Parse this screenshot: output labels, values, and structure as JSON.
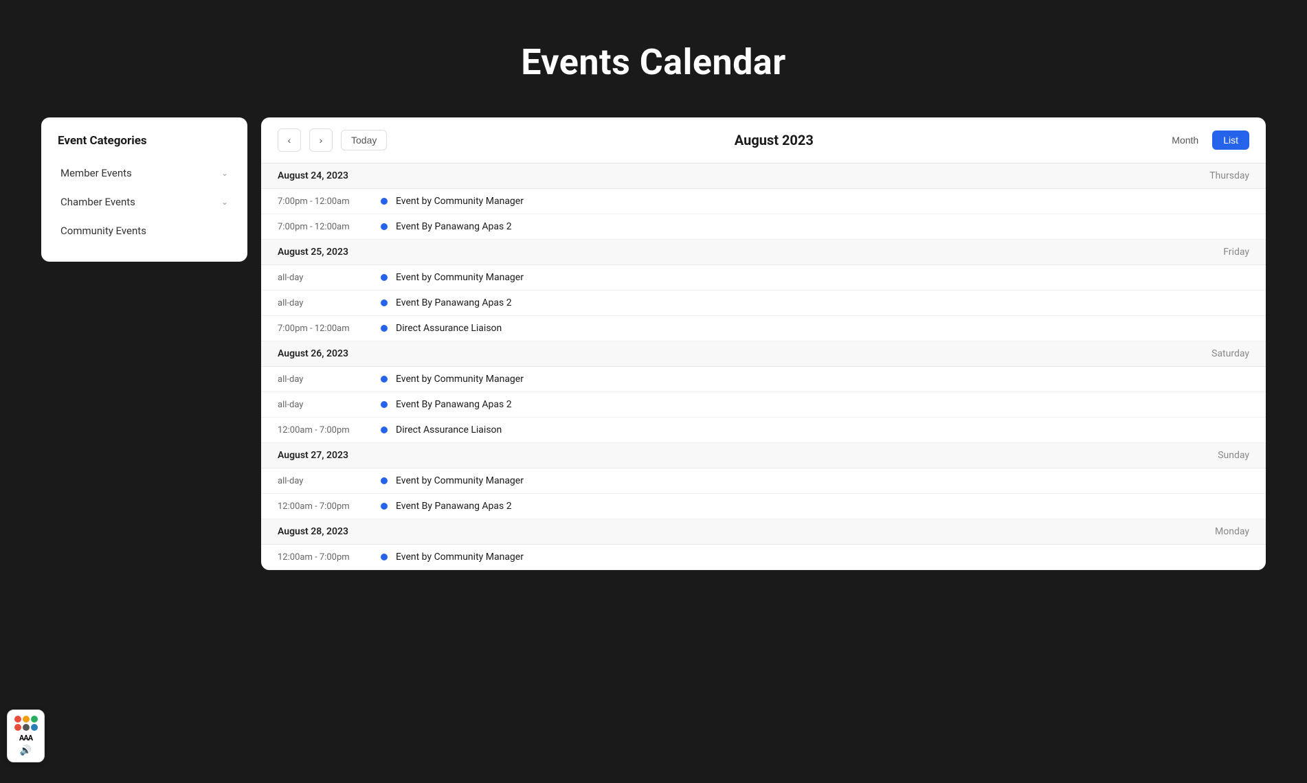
{
  "page": {
    "title": "Events Calendar"
  },
  "sidebar": {
    "title": "Event Categories",
    "categories": [
      {
        "id": "member-events",
        "label": "Member Events",
        "hasDropdown": true
      },
      {
        "id": "chamber-events",
        "label": "Chamber Events",
        "hasDropdown": true
      },
      {
        "id": "community-events",
        "label": "Community Events",
        "hasDropdown": false
      }
    ]
  },
  "calendar": {
    "current_month": "August 2023",
    "prev_label": "‹",
    "next_label": "›",
    "today_label": "Today",
    "view_month_label": "Month",
    "view_list_label": "List",
    "active_view": "list",
    "dates": [
      {
        "date": "August 24, 2023",
        "day": "Thursday",
        "events": [
          {
            "time": "7:00pm - 12:00am",
            "name": "Event by Community Manager"
          },
          {
            "time": "7:00pm - 12:00am",
            "name": "Event By Panawang Apas 2"
          }
        ]
      },
      {
        "date": "August 25, 2023",
        "day": "Friday",
        "events": [
          {
            "time": "all-day",
            "name": "Event by Community Manager"
          },
          {
            "time": "all-day",
            "name": "Event By Panawang Apas 2"
          },
          {
            "time": "7:00pm - 12:00am",
            "name": "Direct Assurance Liaison"
          }
        ]
      },
      {
        "date": "August 26, 2023",
        "day": "Saturday",
        "events": [
          {
            "time": "all-day",
            "name": "Event by Community Manager"
          },
          {
            "time": "all-day",
            "name": "Event By Panawang Apas 2"
          },
          {
            "time": "12:00am - 7:00pm",
            "name": "Direct Assurance Liaison"
          }
        ]
      },
      {
        "date": "August 27, 2023",
        "day": "Sunday",
        "events": [
          {
            "time": "all-day",
            "name": "Event by Community Manager"
          },
          {
            "time": "12:00am - 7:00pm",
            "name": "Event By Panawang Apas 2"
          }
        ]
      },
      {
        "date": "August 28, 2023",
        "day": "Monday",
        "events": [
          {
            "time": "12:00am - 7:00pm",
            "name": "Event by Community Manager"
          }
        ]
      }
    ]
  },
  "accessibility": {
    "dots": [
      {
        "color": "#e74c3c"
      },
      {
        "color": "#f39c12"
      },
      {
        "color": "#27ae60"
      },
      {
        "color": "#e74c3c"
      },
      {
        "color": "#555"
      },
      {
        "color": "#2980b9"
      }
    ],
    "text_size": "AAA",
    "speaker": "🔊"
  }
}
